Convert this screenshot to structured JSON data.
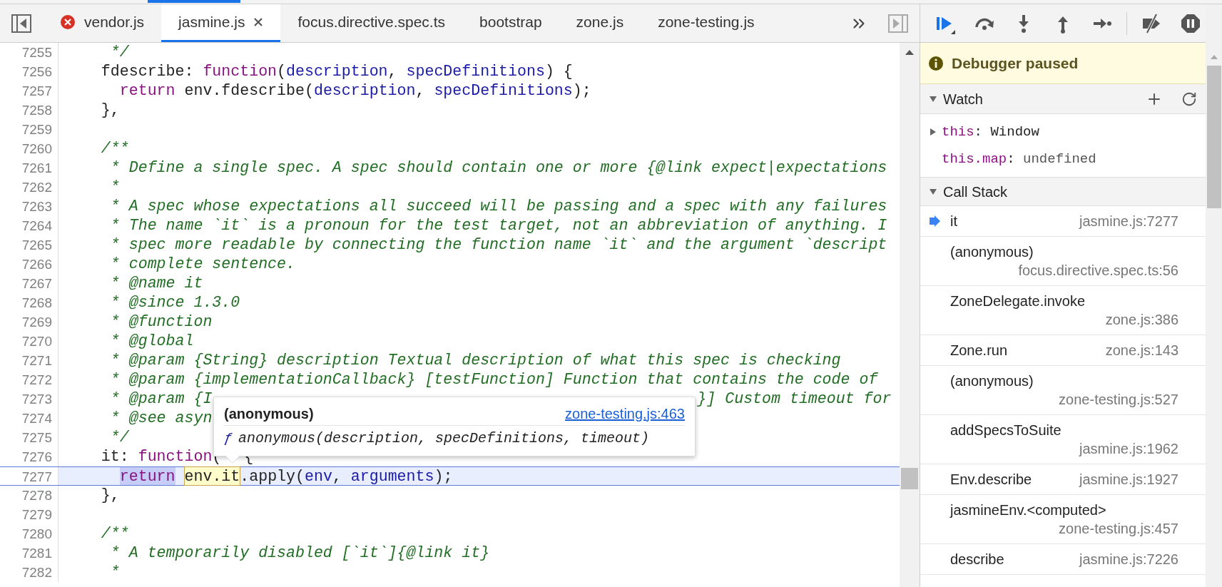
{
  "tabs": [
    {
      "label": "vendor.js",
      "selected": false,
      "error": true
    },
    {
      "label": "jasmine.js",
      "selected": true,
      "error": false
    },
    {
      "label": "focus.directive.spec.ts",
      "selected": false,
      "error": false
    },
    {
      "label": "bootstrap",
      "selected": false,
      "error": false
    },
    {
      "label": "zone.js",
      "selected": false,
      "error": false
    },
    {
      "label": "zone-testing.js",
      "selected": false,
      "error": false
    }
  ],
  "editor": {
    "lines": [
      {
        "num": "7255",
        "current": false,
        "tokens": [
          {
            "text": "     */",
            "kind": "comment"
          }
        ]
      },
      {
        "num": "7256",
        "current": false,
        "tokens": [
          {
            "text": "    fdescribe: ",
            "kind": "plain"
          },
          {
            "text": "function",
            "kind": "keyword"
          },
          {
            "text": "(",
            "kind": "plain"
          },
          {
            "text": "description",
            "kind": "param"
          },
          {
            "text": ", ",
            "kind": "plain"
          },
          {
            "text": "specDefinitions",
            "kind": "param"
          },
          {
            "text": ") {",
            "kind": "plain"
          }
        ]
      },
      {
        "num": "7257",
        "current": false,
        "tokens": [
          {
            "text": "      return",
            "kind": "keyword"
          },
          {
            "text": " env.fdescribe(",
            "kind": "plain"
          },
          {
            "text": "description",
            "kind": "param"
          },
          {
            "text": ", ",
            "kind": "plain"
          },
          {
            "text": "specDefinitions",
            "kind": "param"
          },
          {
            "text": ");",
            "kind": "plain"
          }
        ]
      },
      {
        "num": "7258",
        "current": false,
        "tokens": [
          {
            "text": "    },",
            "kind": "plain"
          }
        ]
      },
      {
        "num": "7259",
        "current": false
      },
      {
        "num": "7260",
        "current": false,
        "tokens": [
          {
            "text": "    /**",
            "kind": "comment"
          }
        ]
      },
      {
        "num": "7261",
        "current": false,
        "tokens": [
          {
            "text": "     * Define a single spec. A spec should contain one or more {@link expect|expectations",
            "kind": "comment"
          }
        ]
      },
      {
        "num": "7262",
        "current": false,
        "tokens": [
          {
            "text": "     *",
            "kind": "comment"
          }
        ]
      },
      {
        "num": "7263",
        "current": false,
        "tokens": [
          {
            "text": "     * A spec whose expectations all succeed will be passing and a spec with any failures",
            "kind": "comment"
          }
        ]
      },
      {
        "num": "7264",
        "current": false,
        "tokens": [
          {
            "text": "     * The name `it` is a pronoun for the test target, not an abbreviation of anything. I",
            "kind": "comment"
          }
        ]
      },
      {
        "num": "7265",
        "current": false,
        "tokens": [
          {
            "text": "     * spec more readable by connecting the function name `it` and the argument `descript",
            "kind": "comment"
          }
        ]
      },
      {
        "num": "7266",
        "current": false,
        "tokens": [
          {
            "text": "     * complete sentence.",
            "kind": "comment"
          }
        ]
      },
      {
        "num": "7267",
        "current": false,
        "tokens": [
          {
            "text": "     * @name it",
            "kind": "comment"
          }
        ]
      },
      {
        "num": "7268",
        "current": false,
        "tokens": [
          {
            "text": "     * @since 1.3.0",
            "kind": "comment"
          }
        ]
      },
      {
        "num": "7269",
        "current": false,
        "tokens": [
          {
            "text": "     * @function",
            "kind": "comment"
          }
        ]
      },
      {
        "num": "7270",
        "current": false,
        "tokens": [
          {
            "text": "     * @global",
            "kind": "comment"
          }
        ]
      },
      {
        "num": "7271",
        "current": false,
        "tokens": [
          {
            "text": "     * @param {String} description Textual description of what this spec is checking",
            "kind": "comment"
          }
        ]
      },
      {
        "num": "7272",
        "current": false,
        "tokens": [
          {
            "text": "     * @param {implementationCallback} [testFunction] Function that contains the code of",
            "kind": "comment"
          }
        ]
      },
      {
        "num": "7273",
        "current": false,
        "tokens": [
          {
            "text": "     * @param {I",
            "kind": "comment"
          },
          {
            "text": "}] Custom timeout for",
            "kind": "comment",
            "after_popup": true
          }
        ]
      },
      {
        "num": "7274",
        "current": false,
        "tokens": [
          {
            "text": "     * @see asyn",
            "kind": "comment"
          }
        ]
      },
      {
        "num": "7275",
        "current": false,
        "tokens": [
          {
            "text": "     */",
            "kind": "comment"
          }
        ]
      },
      {
        "num": "7276",
        "current": false,
        "tokens": [
          {
            "text": "    it: ",
            "kind": "plain"
          },
          {
            "text": "function",
            "kind": "keyword"
          },
          {
            "text": "(",
            "kind": "plain"
          },
          {
            "text": "{",
            "kind": "plain",
            "after_pointer": true
          }
        ]
      },
      {
        "num": "7277",
        "current": true,
        "tokens": [
          {
            "text": "      return",
            "kind": "keyword",
            "selected": true,
            "hovered": false
          },
          {
            "text": " env.it",
            "kind": "plain",
            "selected": false,
            "hovered": true
          },
          {
            "text": ".apply(",
            "kind": "plain",
            "selected": false,
            "hovered": false
          },
          {
            "text": "env",
            "kind": "param",
            "selected": false,
            "hovered": false
          },
          {
            "text": ", ",
            "kind": "plain",
            "selected": false,
            "hovered": false
          },
          {
            "text": "arguments",
            "kind": "param",
            "selected": false,
            "hovered": false
          },
          {
            "text": ");",
            "kind": "plain",
            "selected": false,
            "hovered": false
          }
        ]
      },
      {
        "num": "7278",
        "current": false,
        "tokens": [
          {
            "text": "    },",
            "kind": "plain"
          }
        ]
      },
      {
        "num": "7279",
        "current": false
      },
      {
        "num": "7280",
        "current": false,
        "tokens": [
          {
            "text": "    /**",
            "kind": "comment"
          }
        ]
      },
      {
        "num": "7281",
        "current": false,
        "tokens": [
          {
            "text": "     * A temporarily disabled [`it`]{@link it}",
            "kind": "comment"
          }
        ]
      },
      {
        "num": "7282",
        "current": false,
        "tokens": [
          {
            "text": "     *",
            "kind": "comment"
          }
        ]
      }
    ],
    "popup": {
      "title": "(anonymous)",
      "link": "zone-testing.js:463",
      "symbol": "ƒ",
      "signature": "anonymous(description, specDefinitions, timeout)"
    }
  },
  "banner": "Debugger paused",
  "watch": {
    "title": "Watch",
    "expanded": true,
    "items": [
      {
        "name": "this",
        "separator": ":",
        "value": "Window",
        "expandable": true,
        "kind": "object"
      },
      {
        "name": "this.map",
        "separator": ":",
        "value": "undefined",
        "expandable": false,
        "kind": "undefined"
      }
    ]
  },
  "call_stack": {
    "title": "Call Stack",
    "expanded": true,
    "frames": [
      {
        "name": "it",
        "location": "jasmine.js:7277",
        "selected": true
      },
      {
        "name": "(anonymous)",
        "location": "focus.directive.spec.ts:56",
        "selected": false
      },
      {
        "name": "ZoneDelegate.invoke",
        "location": "zone.js:386",
        "selected": false
      },
      {
        "name": "Zone.run",
        "location": "zone.js:143",
        "selected": false
      },
      {
        "name": "(anonymous)",
        "location": "zone-testing.js:527",
        "selected": false
      },
      {
        "name": "addSpecsToSuite",
        "location": "jasmine.js:1962",
        "selected": false
      },
      {
        "name": "Env.describe",
        "location": "jasmine.js:1927",
        "selected": false
      },
      {
        "name": "jasmineEnv.<computed>",
        "location": "zone-testing.js:457",
        "selected": false
      },
      {
        "name": "describe",
        "location": "jasmine.js:7226",
        "selected": false
      }
    ]
  }
}
